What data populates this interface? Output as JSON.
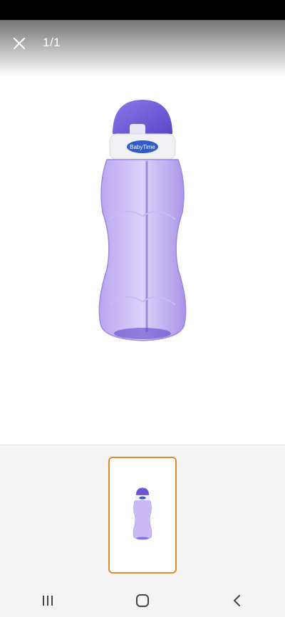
{
  "viewer": {
    "counter": "1/1",
    "close_icon": "close-icon"
  },
  "product": {
    "brand_label": "BabyTime"
  },
  "thumbnails": {
    "selected_index": 0,
    "accent_color": "#e08a2e"
  },
  "navigation": {
    "recent_icon": "recent-apps-icon",
    "home_icon": "home-icon",
    "back_icon": "back-icon"
  }
}
